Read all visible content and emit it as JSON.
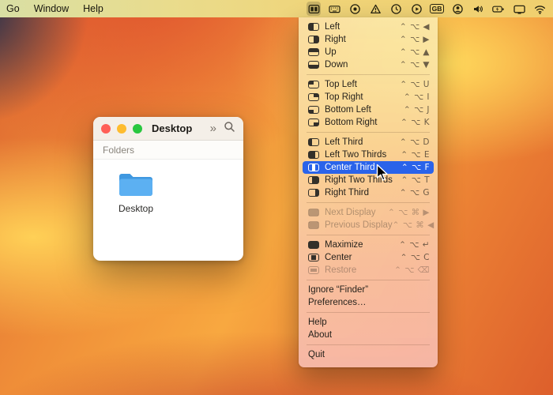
{
  "menubar": {
    "left_items": [
      "Go",
      "Window",
      "Help"
    ],
    "input_source_label": "GB",
    "status_icons": [
      "rectangle",
      "keyboard",
      "round-app",
      "alert",
      "clock",
      "play",
      "input-source",
      "user-account",
      "volume",
      "battery-charging",
      "display",
      "wifi"
    ]
  },
  "finder_window": {
    "title": "Desktop",
    "toolbar_overflow_glyph": "»",
    "section_header": "Folders",
    "items": [
      {
        "label": "Desktop",
        "icon": "folder-icon"
      }
    ]
  },
  "menu": {
    "selection_color": "#2a63ea",
    "items": [
      {
        "label": "Left",
        "shortcut": "⌃ ⌥ ◀",
        "icon": "left-half"
      },
      {
        "label": "Right",
        "shortcut": "⌃ ⌥ ▶",
        "icon": "right-half"
      },
      {
        "label": "Up",
        "shortcut": "⌃ ⌥ ▲",
        "icon": "top-half"
      },
      {
        "label": "Down",
        "shortcut": "⌃ ⌥ ▼",
        "icon": "bottom-half"
      },
      {
        "label": "Top Left",
        "shortcut": "⌃ ⌥ U",
        "icon": "top-left"
      },
      {
        "label": "Top Right",
        "shortcut": "⌃ ⌥ I",
        "icon": "top-right"
      },
      {
        "label": "Bottom Left",
        "shortcut": "⌃ ⌥ J",
        "icon": "bottom-left"
      },
      {
        "label": "Bottom Right",
        "shortcut": "⌃ ⌥ K",
        "icon": "bottom-right"
      },
      {
        "label": "Left Third",
        "shortcut": "⌃ ⌥ D",
        "icon": "left-third"
      },
      {
        "label": "Left Two Thirds",
        "shortcut": "⌃ ⌥ E",
        "icon": "left-two-thirds"
      },
      {
        "label": "Center Third",
        "shortcut": "⌃ ⌥ F",
        "icon": "center-third"
      },
      {
        "label": "Right Two Thirds",
        "shortcut": "⌃ ⌥ T",
        "icon": "right-two-thirds"
      },
      {
        "label": "Right Third",
        "shortcut": "⌃ ⌥ G",
        "icon": "right-third"
      },
      {
        "label": "Next Display",
        "shortcut": "⌃ ⌥ ⌘ ▶",
        "icon": "next-display"
      },
      {
        "label": "Previous Display",
        "shortcut": "⌃ ⌥ ⌘ ◀",
        "icon": "prev-display"
      },
      {
        "label": "Maximize",
        "shortcut": "⌃ ⌥ ↵",
        "icon": "maximize"
      },
      {
        "label": "Center",
        "shortcut": "⌃ ⌥ C",
        "icon": "center"
      },
      {
        "label": "Restore",
        "shortcut": "⌃ ⌥ ⌫",
        "icon": "restore"
      },
      {
        "label": "Ignore “Finder”",
        "shortcut": "",
        "icon": "none"
      },
      {
        "label": "Preferences…",
        "shortcut": "",
        "icon": "none"
      },
      {
        "label": "Help",
        "shortcut": "",
        "icon": "none"
      },
      {
        "label": "About",
        "shortcut": "",
        "icon": "none"
      },
      {
        "label": "Quit",
        "shortcut": "",
        "icon": "none"
      }
    ]
  }
}
